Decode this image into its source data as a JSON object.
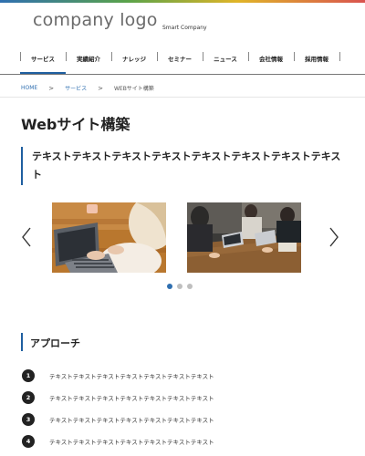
{
  "header": {
    "logo_text": "company logo",
    "tagline": "Smart Company"
  },
  "nav": {
    "items": [
      {
        "label": "サービス",
        "active": true
      },
      {
        "label": "実績紹介",
        "active": false
      },
      {
        "label": "ナレッジ",
        "active": false
      },
      {
        "label": "セミナー",
        "active": false
      },
      {
        "label": "ニュース",
        "active": false
      },
      {
        "label": "会社情報",
        "active": false
      },
      {
        "label": "採用情報",
        "active": false
      }
    ]
  },
  "breadcrumb": {
    "home": "HOME",
    "service": "サービス",
    "current": "WEBサイト構築",
    "separator": ">"
  },
  "page": {
    "title": "Webサイト構築",
    "lead": "テキストテキストテキストテキストテキストテキストテキストテキスト"
  },
  "carousel": {
    "slides": [
      {
        "alt": "laptop-typing-photo"
      },
      {
        "alt": "team-meeting-photo"
      }
    ],
    "dots": 3,
    "active_index": 0
  },
  "approach": {
    "heading": "アプローチ",
    "steps": [
      {
        "num": "1",
        "text": "テキストテキストテキストテキストテキストテキストテキスト"
      },
      {
        "num": "2",
        "text": "テキストテキストテキストテキストテキストテキストテキスト"
      },
      {
        "num": "3",
        "text": "テキストテキストテキストテキストテキストテキストテキスト"
      },
      {
        "num": "4",
        "text": "テキストテキストテキストテキストテキストテキストテキスト"
      }
    ]
  },
  "colors": {
    "accent": "#1f5fa0",
    "link": "#2f6fb0",
    "text": "#222222"
  }
}
